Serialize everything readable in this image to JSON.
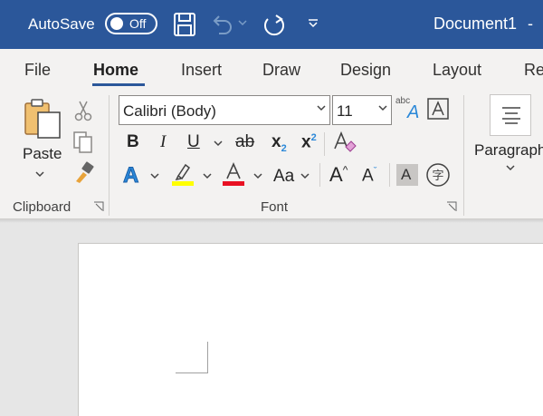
{
  "titlebar": {
    "autosave_label": "AutoSave",
    "autosave_state": "Off",
    "doc_title": "Document1",
    "title_sep": "-",
    "icons": [
      "save-icon",
      "undo-icon",
      "redo-icon",
      "customize-qat-icon"
    ]
  },
  "tabs": [
    "File",
    "Home",
    "Insert",
    "Draw",
    "Design",
    "Layout",
    "Re"
  ],
  "active_tab": "Home",
  "clipboard": {
    "paste_label": "Paste",
    "group_label": "Clipboard"
  },
  "font": {
    "font_name": "Calibri (Body)",
    "font_size": "11",
    "bold": "B",
    "italic": "I",
    "underline": "U",
    "strikethrough": "ab",
    "subscript": "x",
    "subscript_mark": "2",
    "superscript": "x",
    "superscript_mark": "2",
    "change_case": "Aa",
    "grow": "A",
    "shrink": "A",
    "phonetic": "abc",
    "group_label": "Font",
    "highlight_color": "#ffff00",
    "font_color": "#e81123"
  },
  "paragraph": {
    "group_label": "Paragraph"
  },
  "colors": {
    "titlebar": "#2b579a",
    "ribbon": "#f3f2f1",
    "canvas": "#e6e6e6"
  }
}
